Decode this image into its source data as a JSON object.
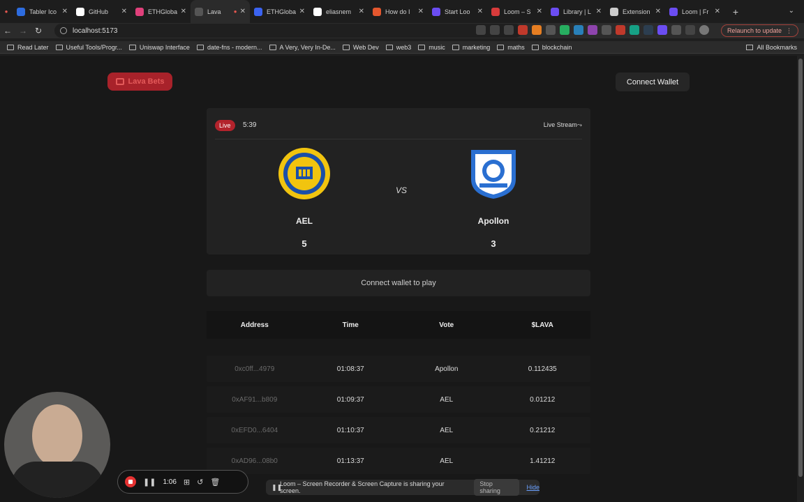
{
  "tabs": [
    {
      "label": "Tabler Ico",
      "color": "#2d6cdf"
    },
    {
      "label": "GitHub",
      "color": "#ffffff"
    },
    {
      "label": "ETHGloba",
      "color": "#e0407b"
    },
    {
      "label": "Lava",
      "color": "#555555",
      "active": true
    },
    {
      "label": "ETHGloba",
      "color": "#3b63f0"
    },
    {
      "label": "eliasnem",
      "color": "#ffffff"
    },
    {
      "label": "How do I",
      "color": "#e4572e"
    },
    {
      "label": "Start Loo",
      "color": "#6b4df2"
    },
    {
      "label": "Loom – S",
      "color": "#d83b3b"
    },
    {
      "label": "Library | L",
      "color": "#6b4df2"
    },
    {
      "label": "Extension",
      "color": "#cccccc"
    },
    {
      "label": "Loom | Fr",
      "color": "#6b4df2"
    }
  ],
  "url": "localhost:5173",
  "relaunch_label": "Relaunch to update",
  "bookmarks": [
    "Read Later",
    "Useful Tools/Progr...",
    "Uniswap Interface",
    "date-fns - modern...",
    "A Very, Very In-De...",
    "Web Dev",
    "web3",
    "music",
    "marketing",
    "maths",
    "blockchain"
  ],
  "all_bookmarks": "All Bookmarks",
  "brand": "Lava Bets",
  "connect_wallet": "Connect Wallet",
  "match": {
    "live_badge": "Live",
    "clock": "5:39",
    "stream_label": "Live Stream⤳",
    "vs": "VS",
    "home": {
      "name": "AEL",
      "score": "5"
    },
    "away": {
      "name": "Apollon",
      "score": "3"
    }
  },
  "play_message": "Connect wallet to play",
  "table": {
    "headers": [
      "Address",
      "Time",
      "Vote",
      "$LAVA"
    ],
    "rows": [
      [
        "0xc0ff...4979",
        "01:08:37",
        "Apollon",
        "0.112435"
      ],
      [
        "0xAF91...b809",
        "01:09:37",
        "AEL",
        "0.01212"
      ],
      [
        "0xEFD0...6404",
        "01:10:37",
        "AEL",
        "0.21212"
      ],
      [
        "0xAD96...08b0",
        "01:13:37",
        "AEL",
        "1.41212"
      ]
    ]
  },
  "sharing": {
    "message": "Loom – Screen Recorder & Screen Capture is sharing your screen.",
    "stop": "Stop sharing",
    "hide": "Hide"
  },
  "recorder": {
    "elapsed": "1:06"
  },
  "colors": {
    "accent_red": "#b3232c",
    "link_blue": "#6aa0ff"
  }
}
